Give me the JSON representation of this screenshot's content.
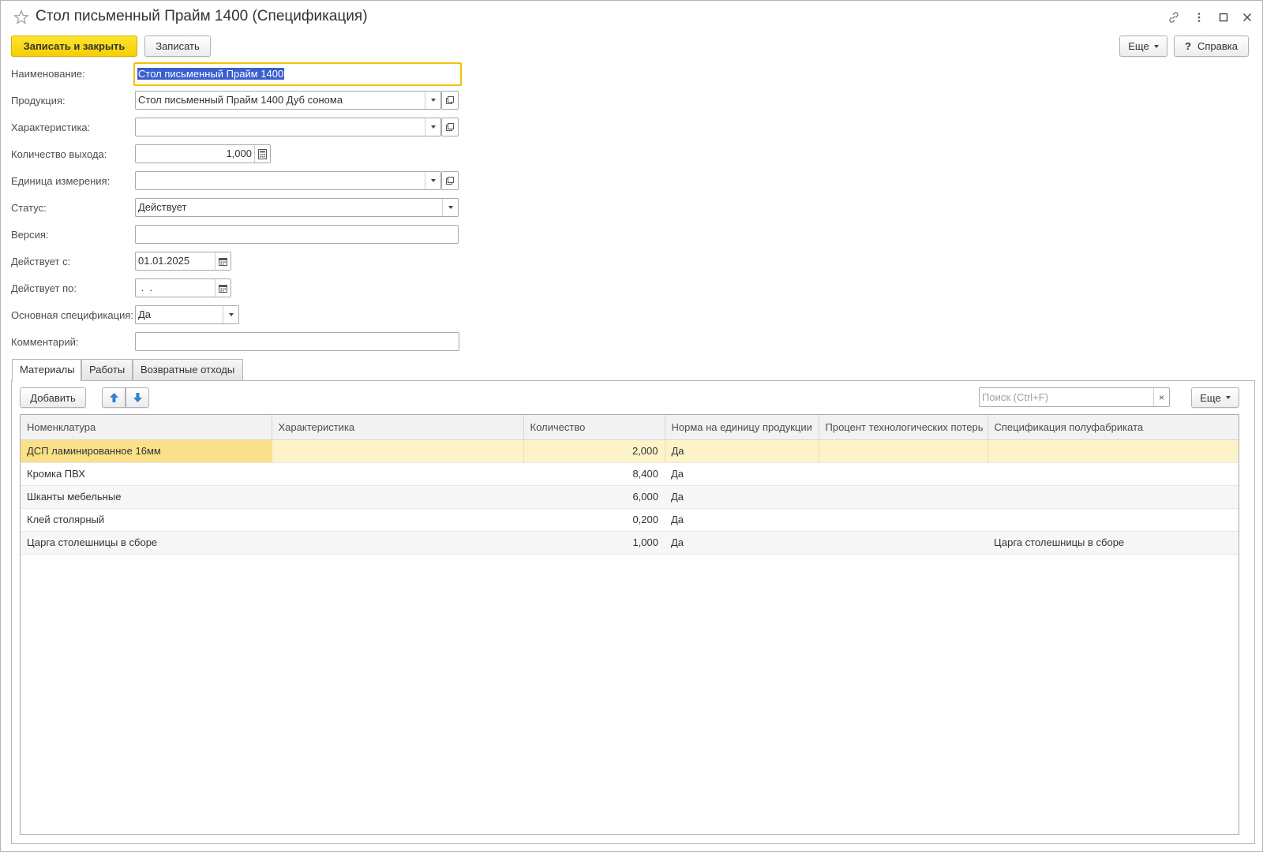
{
  "window": {
    "title": "Стол письменный Прайм 1400 (Спецификация)"
  },
  "toolbar": {
    "save_close_label": "Записать и закрыть",
    "save_label": "Записать",
    "more_label": "Еще",
    "help_label": "Справка",
    "help_icon": "?"
  },
  "form": {
    "name": {
      "label": "Наименование:",
      "value": "Стол письменный Прайм 1400"
    },
    "product": {
      "label": "Продукция:",
      "value": "Стол письменный Прайм 1400 Дуб сонома"
    },
    "characteristic": {
      "label": "Характеристика:",
      "value": ""
    },
    "output_qty": {
      "label": "Количество выхода:",
      "value": "1,000"
    },
    "unit": {
      "label": "Единица измерения:",
      "value": ""
    },
    "status": {
      "label": "Статус:",
      "value": "Действует"
    },
    "version": {
      "label": "Версия:",
      "value": ""
    },
    "valid_from": {
      "label": "Действует с:",
      "value": "01.01.2025"
    },
    "valid_to": {
      "label": "Действует по:",
      "value": " .  ."
    },
    "main_spec": {
      "label": "Основная спецификация:",
      "value": "Да"
    },
    "comment": {
      "label": "Комментарий:",
      "value": ""
    }
  },
  "tabs": [
    {
      "label": "Материалы",
      "active": true
    },
    {
      "label": "Работы",
      "active": false
    },
    {
      "label": "Возвратные отходы",
      "active": false
    }
  ],
  "materials": {
    "add_label": "Добавить",
    "search_placeholder": "Поиск (Ctrl+F)",
    "search_clear": "×",
    "more_label": "Еще",
    "columns": [
      "Номенклатура",
      "Характеристика",
      "Количество",
      "Норма на единицу продукции",
      "Процент технологических потерь",
      "Спецификация полуфабриката"
    ],
    "rows": [
      [
        "ДСП ламинированное 16мм",
        "",
        "2,000",
        "Да",
        "",
        ""
      ],
      [
        "Кромка ПВХ",
        "",
        "8,400",
        "Да",
        "",
        ""
      ],
      [
        "Шканты мебельные",
        "",
        "6,000",
        "Да",
        "",
        ""
      ],
      [
        "Клей столярный",
        "",
        "0,200",
        "Да",
        "",
        ""
      ],
      [
        "Царга столешницы в сборе",
        "",
        "1,000",
        "Да",
        "",
        "Царга столешницы в сборе"
      ]
    ]
  },
  "colors": {
    "primary_button": "#f5cf00",
    "focus_border": "#f2c200",
    "selected_row": "#fdf3c8",
    "arrow_blue": "#2f7fd6"
  },
  "icons": {
    "favorite": "star-icon",
    "link": "link-icon",
    "menu": "more-vertical-icon",
    "maximize": "maximize-icon",
    "close": "close-icon",
    "calculator": "calculator-icon",
    "calendar": "calendar-icon",
    "open": "open-icon",
    "move_up": "arrow-up-icon",
    "move_down": "arrow-down-icon"
  }
}
